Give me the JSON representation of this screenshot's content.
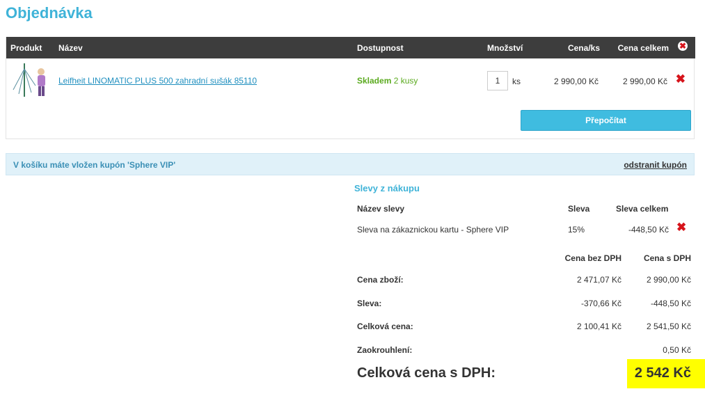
{
  "page": {
    "title": "Objednávka"
  },
  "cart": {
    "headers": {
      "product": "Produkt",
      "name": "Název",
      "availability": "Dostupnost",
      "quantity": "Množství",
      "unit_price": "Cena/ks",
      "total": "Cena celkem"
    },
    "items": [
      {
        "name": "Leifheit LINOMATIC PLUS 500 zahradní sušák 85110",
        "availability_status": "Skladem",
        "availability_count": "2 kusy",
        "quantity": "1",
        "unit": "ks",
        "unit_price": "2 990,00 Kč",
        "total": "2 990,00 Kč"
      }
    ],
    "recalculate_label": "Přepočítat"
  },
  "coupon": {
    "message": "V košíku máte vložen kupón 'Sphere VIP'",
    "remove_label": "odstranit kupón"
  },
  "discounts": {
    "title": "Slevy z nákupu",
    "headers": {
      "name": "Název slevy",
      "discount": "Sleva",
      "total": "Sleva celkem"
    },
    "rows": [
      {
        "name": "Sleva na zákaznickou kartu - Sphere VIP",
        "discount": "15%",
        "total": "-448,50 Kč"
      }
    ]
  },
  "summary": {
    "headers": {
      "without_vat": "Cena bez DPH",
      "with_vat": "Cena s DPH"
    },
    "rows": [
      {
        "label": "Cena zboží:",
        "without_vat": "2 471,07 Kč",
        "with_vat": "2 990,00 Kč"
      },
      {
        "label": "Sleva:",
        "without_vat": "-370,66 Kč",
        "with_vat": "-448,50 Kč"
      },
      {
        "label": "Celková cena:",
        "without_vat": "2 100,41 Kč",
        "with_vat": "2 541,50 Kč"
      },
      {
        "label": "Zaokrouhlení:",
        "without_vat": "",
        "with_vat": "0,50 Kč"
      }
    ],
    "grand_total_label": "Celková cena s DPH:",
    "grand_total_value": "2 542 Kč"
  },
  "colors": {
    "accent": "#3fb3d8",
    "header_bg": "#3d3d3d",
    "stock_green": "#5aaa1e",
    "delete_red": "#d6141b",
    "highlight": "#ffff00"
  }
}
